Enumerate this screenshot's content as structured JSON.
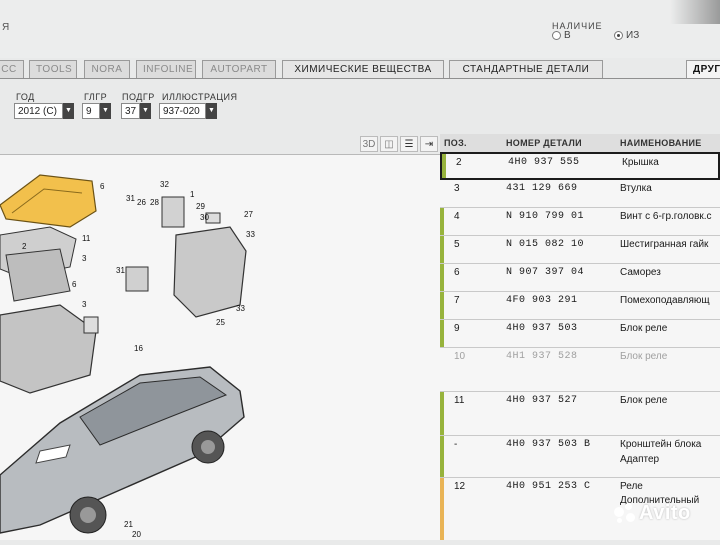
{
  "header": {
    "corner_letter": "Я",
    "availability_label": "НАЛИЧИЕ",
    "radio_in": "В",
    "radio_out": "ИЗ"
  },
  "tabs": [
    {
      "label": "CC",
      "active": false
    },
    {
      "label": "TOOLS",
      "active": false
    },
    {
      "label": "NORA",
      "active": false
    },
    {
      "label": "INFOLINE",
      "active": false
    },
    {
      "label": "AUTOPART",
      "active": false
    },
    {
      "label": "ХИМИЧЕСКИЕ ВЕЩЕСТВА",
      "active": false
    },
    {
      "label": "СТАНДАРТНЫЕ ДЕТАЛИ",
      "active": false
    },
    {
      "label": "ДРУГ",
      "active": true
    }
  ],
  "filters": {
    "year_label": "ГОД",
    "year_value": "2012 (С)",
    "main_group_label": "ГЛГР",
    "main_group_value": "9",
    "sub_group_label": "ПОДГР",
    "sub_group_value": "37",
    "illustration_label": "ИЛЛЮСТРАЦИЯ",
    "illustration_value": "937-020"
  },
  "toolbar": {
    "view3d_label": "3D",
    "list_icon": "list-icon",
    "expand_icon": "expand-arrows-icon"
  },
  "diagram": {
    "callouts": [
      "6",
      "32",
      "1",
      "31",
      "26",
      "28",
      "29",
      "30",
      "27",
      "11",
      "31",
      "33",
      "33",
      "3",
      "6",
      "3",
      "25",
      "16",
      "2",
      "21",
      "20"
    ]
  },
  "table": {
    "headers": {
      "pos": "ПОЗ.",
      "part_number": "НОМЕР ДЕТАЛИ",
      "name": "НАИМЕНОВАНИЕ"
    },
    "rows": [
      {
        "pos": "2",
        "part": "4H0  937  555",
        "name": "Крышка",
        "name2": "",
        "marker": true,
        "selected": true,
        "dim": false
      },
      {
        "pos": "3",
        "part": "431  129  669",
        "name": "Втулка",
        "name2": "",
        "marker": false,
        "selected": false,
        "dim": false
      },
      {
        "pos": "4",
        "part": "N    910  799  01",
        "name": "Винт с 6-гр.головк.с",
        "name2": "",
        "marker": true,
        "selected": false,
        "dim": false
      },
      {
        "pos": "5",
        "part": "N    015  082  10",
        "name": "Шестигранная гайк",
        "name2": "",
        "marker": true,
        "selected": false,
        "dim": false
      },
      {
        "pos": "6",
        "part": "N    907  397  04",
        "name": "Саморез",
        "name2": "",
        "marker": true,
        "selected": false,
        "dim": false
      },
      {
        "pos": "7",
        "part": "4F0  903  291",
        "name": "Помехоподавляющ",
        "name2": "",
        "marker": true,
        "selected": false,
        "dim": false
      },
      {
        "pos": "9",
        "part": "4H0  937  503",
        "name": "Блок реле",
        "name2": "",
        "marker": true,
        "selected": false,
        "dim": false
      },
      {
        "pos": "10",
        "part": "4H1  937  528",
        "name": "Блок реле",
        "name2": "",
        "marker": false,
        "selected": false,
        "dim": true
      },
      {
        "pos": "11",
        "part": "4H0  937  527",
        "name": "Блок реле",
        "name2": "",
        "marker": true,
        "selected": false,
        "dim": false
      },
      {
        "pos": "-",
        "part": "4H0  937  503 B",
        "name": "Кронштейн блока",
        "name2": "Адаптер",
        "marker": true,
        "selected": false,
        "dim": false
      },
      {
        "pos": "12",
        "part": "4H0  951  253 C",
        "name": "Реле",
        "name2": "Дополнительный",
        "marker": true,
        "selected": false,
        "dim": false
      }
    ]
  },
  "watermark": {
    "text": "Avito"
  },
  "colors": {
    "marker_green": "#97b33c",
    "cover_yellow": "#f2c04c",
    "background": "#e9eaea"
  }
}
